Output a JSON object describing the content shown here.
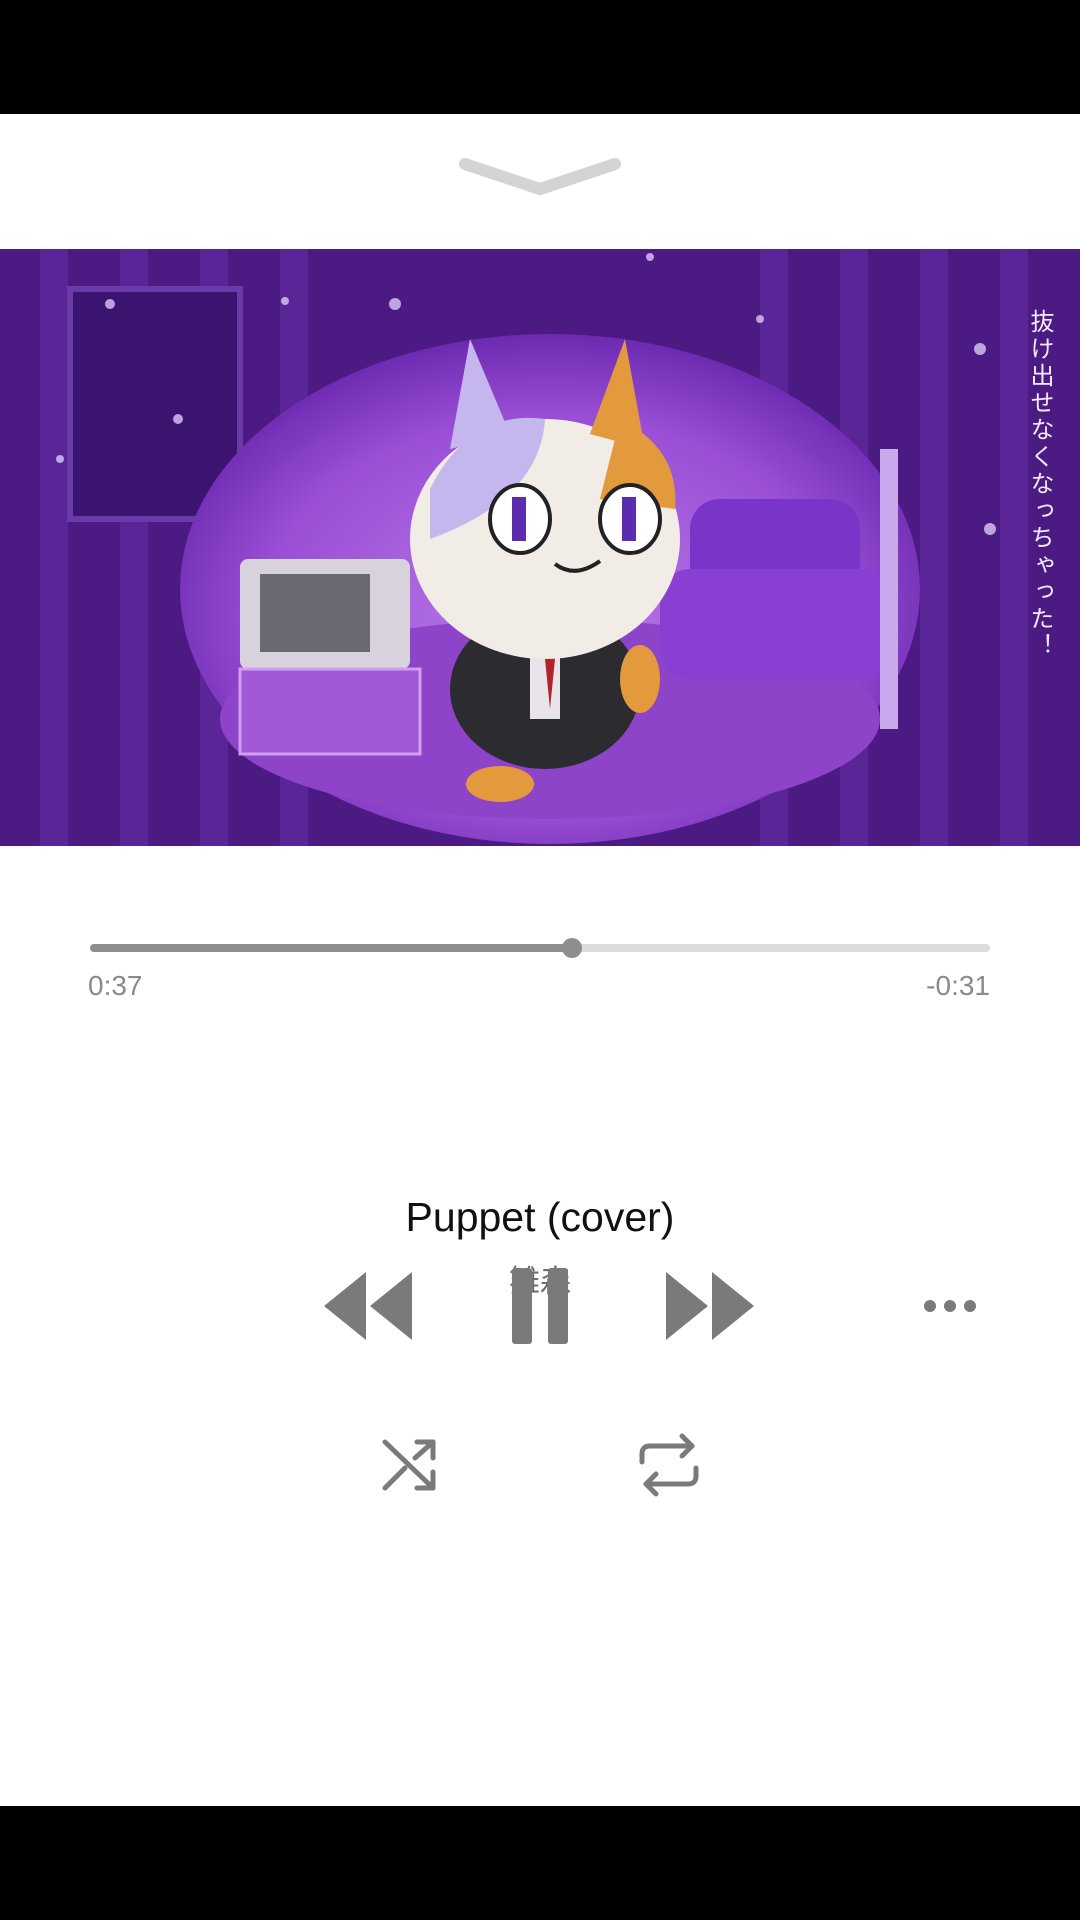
{
  "player": {
    "artwork": {
      "caption": "抜け出せなくなっちゃった！",
      "colors": {
        "background": "#4b1a82",
        "spotlight": "#a45be0",
        "floor": "#8e44c9"
      }
    },
    "progress": {
      "elapsed": "0:37",
      "remaining": "-0:31",
      "fraction": 0.535
    },
    "track": {
      "title": "Puppet (cover)",
      "artist": "雛森"
    },
    "controls": {
      "dismiss_icon": "chevron-down-icon",
      "previous_icon": "rewind-icon",
      "play_pause_icon": "pause-icon",
      "next_icon": "fast-forward-icon",
      "more_icon": "more-icon",
      "shuffle_icon": "shuffle-icon",
      "repeat_icon": "repeat-icon"
    },
    "colors": {
      "accent": "#8e8e8e",
      "controls": "#7a7a7a",
      "track": "#dcdcdc"
    }
  }
}
